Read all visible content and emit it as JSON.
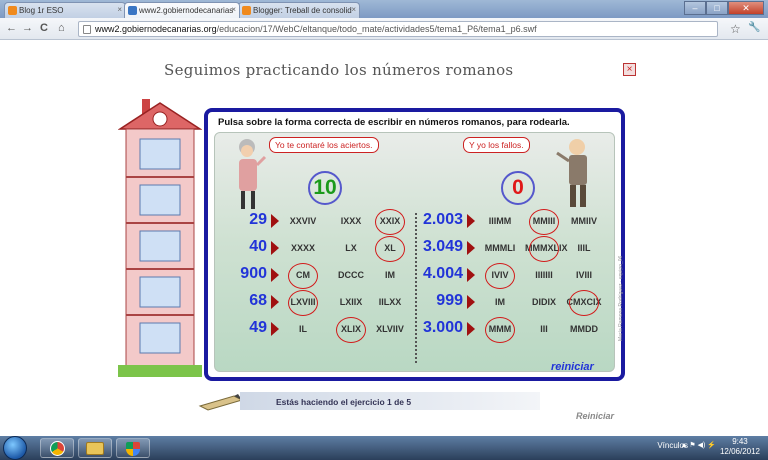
{
  "browser": {
    "tabs": [
      {
        "label": "Blog 1r ESO",
        "active": false
      },
      {
        "label": "www2.gobiernodecanarias",
        "active": true
      },
      {
        "label": "Blogger: Treball de consolid",
        "active": false
      }
    ],
    "url_domain": "www2.gobiernodecanarias.org",
    "url_path": "/educacion/17/WebC/eltanque/todo_mate/actividades5/tema1_P6/tema1_p6.swf",
    "nav": {
      "back": "←",
      "forward": "→",
      "reload": "C",
      "home": "⌂"
    },
    "star_icon": "☆",
    "wrench_icon": "🔧"
  },
  "activity": {
    "title": "Seguimos practicando los números romanos",
    "close_label": "×",
    "instruction": "Pulsa sobre la forma correcta de escribir en números romanos, para rodearla.",
    "bubble_left": "Yo te contaré los aciertos.",
    "bubble_right": "Y yo los fallos.",
    "hits": "10",
    "misses": "0",
    "left_rows": [
      {
        "number": "29",
        "options": [
          "XXVIV",
          "IXXX",
          "XXIX"
        ],
        "circled": 2
      },
      {
        "number": "40",
        "options": [
          "XXXX",
          "LX",
          "XL"
        ],
        "circled": 2
      },
      {
        "number": "900",
        "options": [
          "CM",
          "DCCC",
          "IM"
        ],
        "circled": 0
      },
      {
        "number": "68",
        "options": [
          "LXVIII",
          "LXIIX",
          "IILXX"
        ],
        "circled": 0
      },
      {
        "number": "49",
        "options": [
          "IL",
          "XLIX",
          "XLVIIV"
        ],
        "circled": 1
      }
    ],
    "right_rows": [
      {
        "number": "2.003",
        "options": [
          "IIIMM",
          "MMIII",
          "MMIIV"
        ],
        "circled": 1
      },
      {
        "number": "3.049",
        "options": [
          "MMMLI",
          "MMMXLIX",
          "IIIL"
        ],
        "circled": 1
      },
      {
        "number": "4.004",
        "options": [
          "IVIV",
          "IIIIIII",
          "IVIII"
        ],
        "circled": 0
      },
      {
        "number": "999",
        "options": [
          "IM",
          "DIDIX",
          "CMXCIX"
        ],
        "circled": 2
      },
      {
        "number": "3.000",
        "options": [
          "MMM",
          "III",
          "MMDD"
        ],
        "circled": 0
      }
    ],
    "reset_link": "reiniciar",
    "status": "Estás haciendo el ejercicio   1    de 5",
    "reset_footer": "Reiniciar",
    "credit": "María Ramona Rodríguez · equipo_06"
  },
  "taskbar": {
    "tray_label": "Vínculos",
    "time": "9:43",
    "date": "12/06/2012"
  },
  "colors": {
    "board_border": "#1a1aa0",
    "number_blue": "#2234d8",
    "ring_red": "#d21a1a",
    "score_green": "#1b9a1b",
    "score_red": "#e01818"
  }
}
